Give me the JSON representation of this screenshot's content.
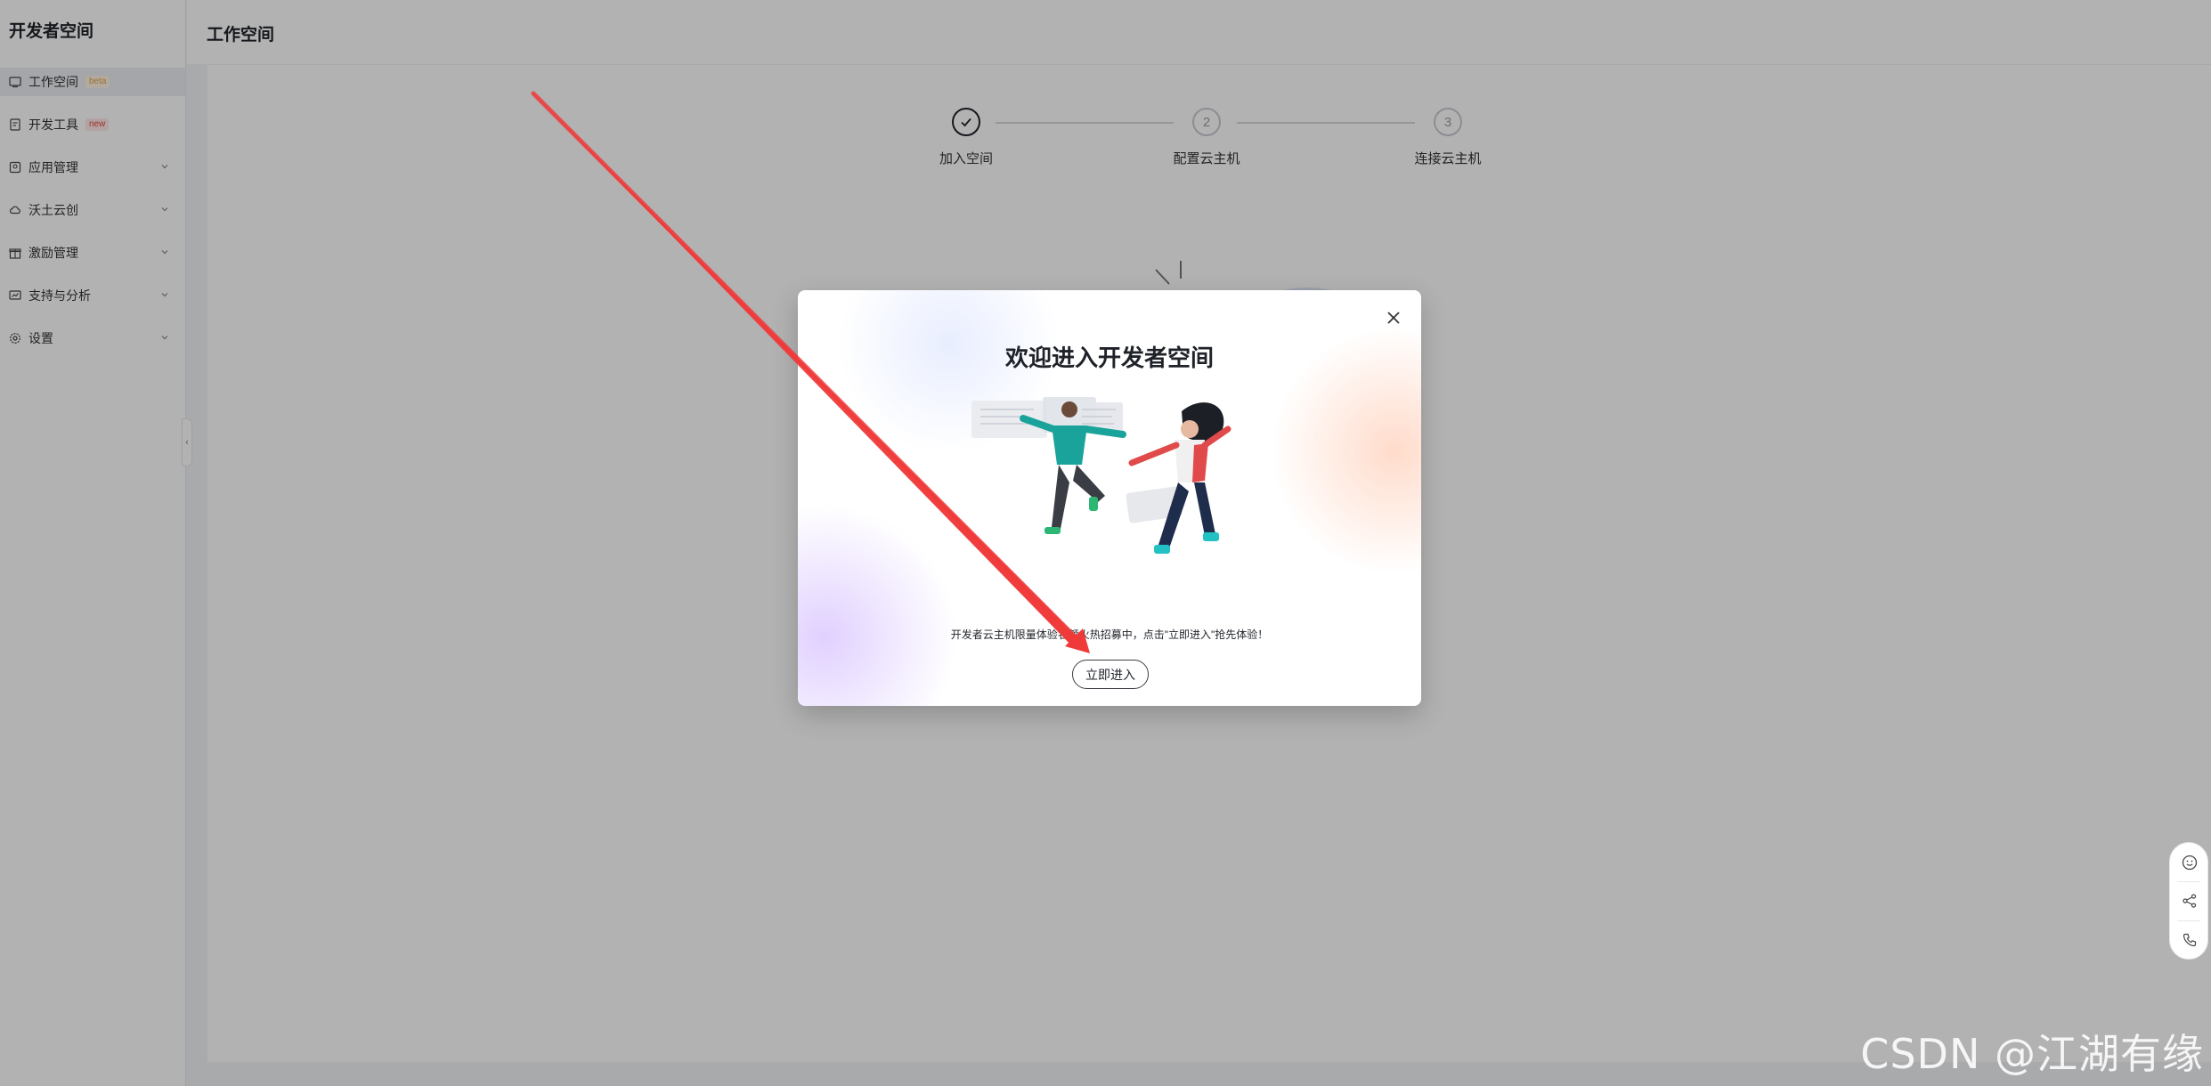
{
  "sidebar": {
    "brand": "开发者空间",
    "items": [
      {
        "label": "工作空间",
        "tag": "beta",
        "icon": "workspace-icon",
        "active": true
      },
      {
        "label": "开发工具",
        "tag": "new",
        "icon": "dev-tools-icon"
      },
      {
        "label": "应用管理",
        "icon": "app-manage-icon",
        "expandable": true
      },
      {
        "label": "沃土云创",
        "icon": "cloud-icon",
        "expandable": true
      },
      {
        "label": "激励管理",
        "icon": "gift-icon",
        "expandable": true
      },
      {
        "label": "支持与分析",
        "icon": "analytics-icon",
        "expandable": true
      },
      {
        "label": "设置",
        "icon": "gear-icon",
        "expandable": true
      }
    ]
  },
  "header": {
    "title": "工作空间"
  },
  "stepper": {
    "steps": [
      {
        "index": "1",
        "label": "加入空间",
        "status": "done"
      },
      {
        "index": "2",
        "label": "配置云主机",
        "status": "pending"
      },
      {
        "index": "3",
        "label": "连接云主机",
        "status": "pending"
      }
    ]
  },
  "modal": {
    "title": "欢迎进入开发者空间",
    "description": "开发者云主机限量体验名额火热招募中，点击\"立即进入\"抢先体验！",
    "button_label": "立即进入",
    "close_icon": "close-icon"
  },
  "float_tools": {
    "icons": [
      "smile-icon",
      "share-icon",
      "phone-icon"
    ]
  },
  "watermark": "CSDN @江湖有缘",
  "colors": {
    "annotation_arrow": "#f03a3a",
    "overlay": "rgba(0,0,0,0.30)",
    "tag_beta": "#e0a34a",
    "tag_new": "#e0473f"
  }
}
